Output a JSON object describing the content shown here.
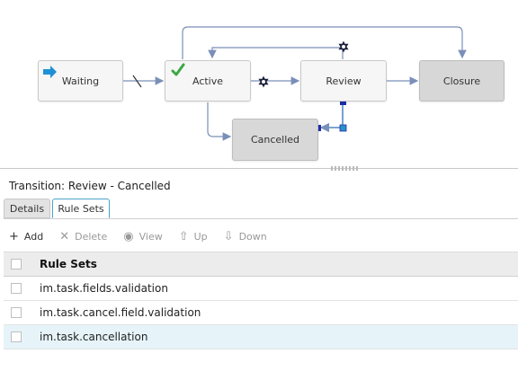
{
  "workflow": {
    "states": {
      "waiting": "Waiting",
      "active": "Active",
      "review": "Review",
      "closure": "Closure",
      "cancelled": "Cancelled"
    }
  },
  "transition_title": "Transition: Review - Cancelled",
  "tabs": [
    {
      "label": "Details",
      "active": false
    },
    {
      "label": "Rule Sets",
      "active": true
    }
  ],
  "toolbar": {
    "add": "Add",
    "delete": "Delete",
    "view": "View",
    "up": "Up",
    "down": "Down"
  },
  "grid": {
    "header": "Rule Sets",
    "rows": [
      {
        "value": "im.task.fields.validation"
      },
      {
        "value": "im.task.cancel.field.validation"
      },
      {
        "value": "im.task.cancellation",
        "selected": true
      }
    ]
  },
  "colors": {
    "connector": "#7a8fb8",
    "handle": "#1c2fa8",
    "handle_alt": "#2d8fc9",
    "tab_accent": "#4aa3c9",
    "check": "#3aa845",
    "start_arrow": "#1e90d6"
  }
}
